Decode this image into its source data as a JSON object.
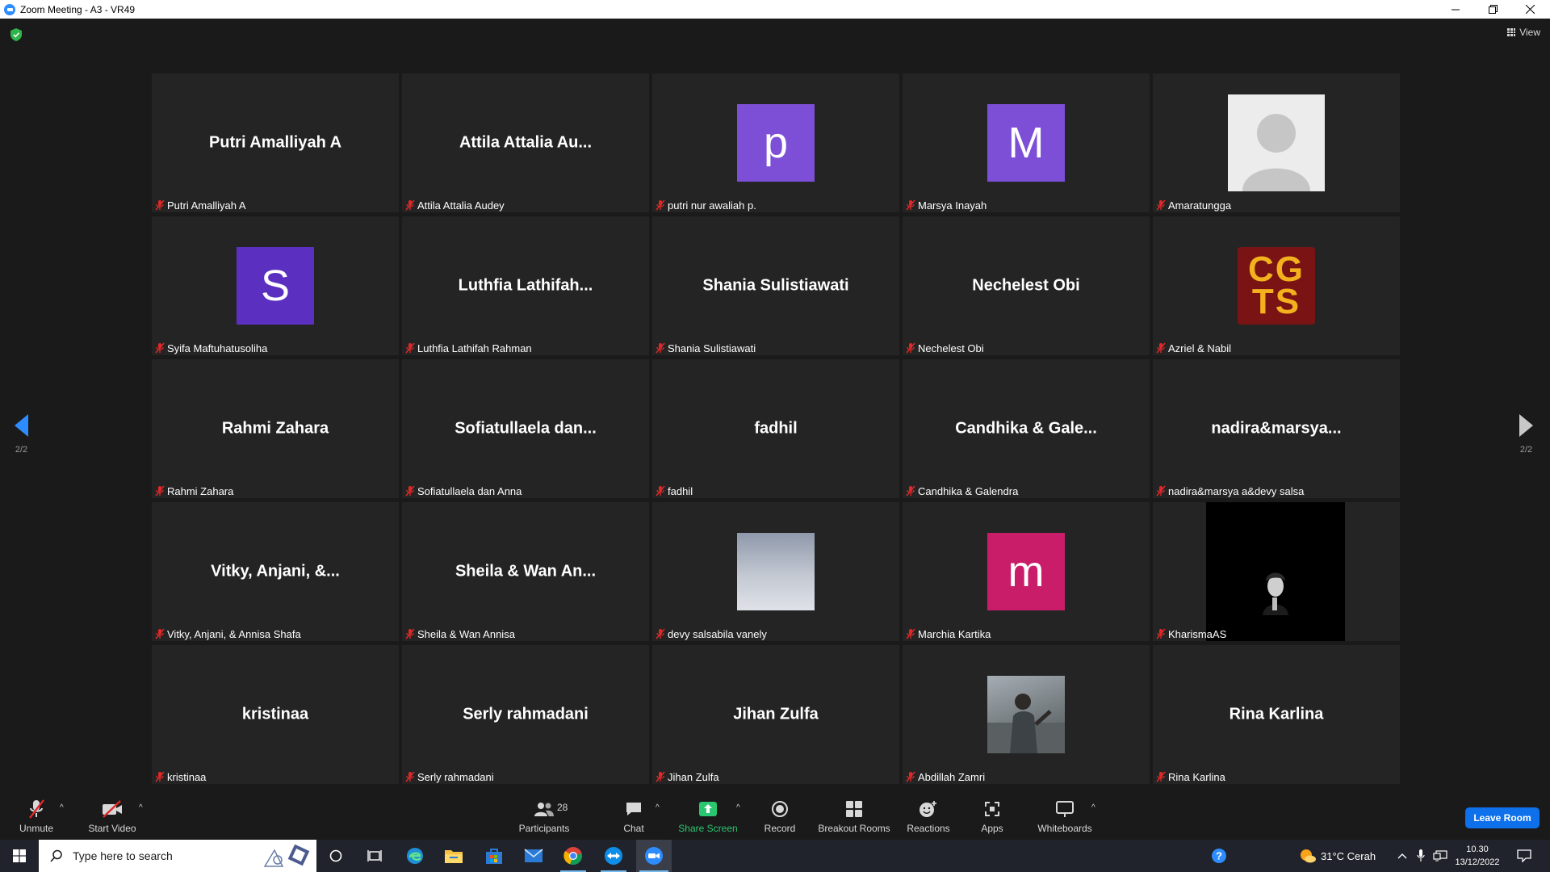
{
  "window": {
    "title": "Zoom Meeting - A3 - VR49"
  },
  "view": {
    "label": "View"
  },
  "pager": {
    "left": "2/2",
    "right": "2/2"
  },
  "participants": [
    {
      "display": "Putri Amalliyah A",
      "label": "Putri Amalliyah A",
      "tile": "name"
    },
    {
      "display": "Attila Attalia Au...",
      "label": "Attila Attalia Audey",
      "tile": "name"
    },
    {
      "display": "p",
      "label": "putri nur awaliah p.",
      "tile": "avatar",
      "color": "#7c4fd6"
    },
    {
      "display": "M",
      "label": "Marsya Inayah",
      "tile": "avatar",
      "color": "#7c4fd6"
    },
    {
      "display": "",
      "label": "Amaratungga",
      "tile": "generic-avatar"
    },
    {
      "display": "S",
      "label": "Syifa Maftuhatusoliha",
      "tile": "avatar",
      "color": "#5b2fc0"
    },
    {
      "display": "Luthfia  Lathifah...",
      "label": "Luthfia Lathifah Rahman",
      "tile": "name"
    },
    {
      "display": "Shania Sulistiawati",
      "label": "Shania Sulistiawati",
      "tile": "name"
    },
    {
      "display": "Nechelest Obi",
      "label": "Nechelest Obi",
      "tile": "name"
    },
    {
      "display": "CG TS",
      "label": "Azriel & Nabil",
      "tile": "logo",
      "color": "#7a1313"
    },
    {
      "display": "Rahmi Zahara",
      "label": "Rahmi Zahara",
      "tile": "name"
    },
    {
      "display": "Sofiatullaela  dan...",
      "label": "Sofiatullaela dan Anna",
      "tile": "name"
    },
    {
      "display": "fadhil",
      "label": "fadhil",
      "tile": "name"
    },
    {
      "display": "Candhika & Gale...",
      "label": "Candhika & Galendra",
      "tile": "name"
    },
    {
      "display": "nadira&marsya...",
      "label": "nadira&marsya a&devy salsa",
      "tile": "name"
    },
    {
      "display": "Vitky,  Anjani,  &...",
      "label": "Vitky, Anjani, & Annisa Shafa",
      "tile": "name"
    },
    {
      "display": "Sheila & Wan An...",
      "label": "Sheila & Wan Annisa",
      "tile": "name"
    },
    {
      "display": "",
      "label": "devy salsabila vanely",
      "tile": "sky-photo"
    },
    {
      "display": "m",
      "label": "Marchia Kartika",
      "tile": "avatar",
      "color": "#c91d6a"
    },
    {
      "display": "",
      "label": "KharismaAS",
      "tile": "video"
    },
    {
      "display": "kristinaa",
      "label": "kristinaa",
      "tile": "name"
    },
    {
      "display": "Serly rahmadani",
      "label": "Serly rahmadani",
      "tile": "name"
    },
    {
      "display": "Jihan Zulfa",
      "label": "Jihan Zulfa",
      "tile": "name"
    },
    {
      "display": "",
      "label": "Abdillah Zamri",
      "tile": "photo"
    },
    {
      "display": "Rina Karlina",
      "label": "Rina Karlina",
      "tile": "name"
    }
  ],
  "toolbar": {
    "unmute": "Unmute",
    "start_video": "Start Video",
    "participants": "Participants",
    "participants_count": "28",
    "chat": "Chat",
    "share_screen": "Share Screen",
    "record": "Record",
    "breakout_rooms": "Breakout Rooms",
    "reactions": "Reactions",
    "apps": "Apps",
    "whiteboards": "Whiteboards",
    "leave": "Leave Room"
  },
  "taskbar": {
    "search_placeholder": "Type here to search",
    "weather": "31°C  Cerah",
    "time": "10.30",
    "date": "13/12/2022"
  },
  "colors": {
    "accent": "#2d8cff",
    "leave": "#0e71eb",
    "share": "#29c76f",
    "muted_mic": "#e02828"
  }
}
